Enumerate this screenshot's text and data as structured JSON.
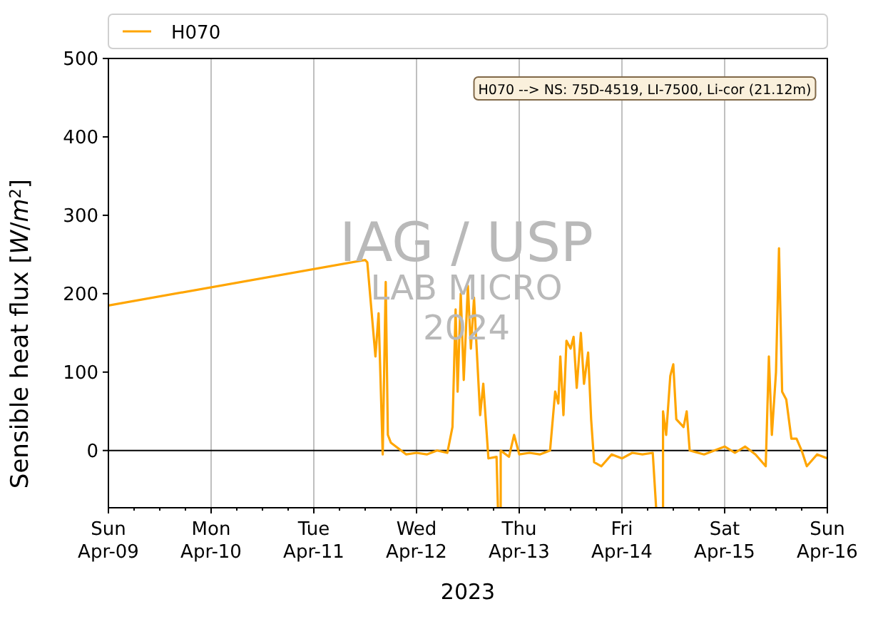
{
  "chart_data": {
    "type": "line",
    "xlabel": "2023",
    "ylabel": "Sensible heat flux [*W*/*m*$^{2}$]",
    "x": [
      "2023-04-09T00:00",
      "2023-04-11T12:00",
      "2023-04-11T12:29",
      "2023-04-11T14:24",
      "2023-04-11T15:07",
      "2023-04-11T16:05",
      "2023-04-11T16:48",
      "2023-04-11T17:17",
      "2023-04-11T18:00",
      "2023-04-11T19:12",
      "2023-04-11T21:36",
      "2023-04-12T00:00",
      "2023-04-12T02:24",
      "2023-04-12T04:48",
      "2023-04-12T07:12",
      "2023-04-12T08:24",
      "2023-04-12T09:07",
      "2023-04-12T09:36",
      "2023-04-12T10:19",
      "2023-04-12T11:02",
      "2023-04-12T12:00",
      "2023-04-12T12:43",
      "2023-04-12T13:26",
      "2023-04-12T14:53",
      "2023-04-12T15:36",
      "2023-04-12T16:48",
      "2023-04-12T18:43",
      "2023-04-12T19:12",
      "2023-04-12T19:41",
      "2023-04-12T21:36",
      "2023-04-12T22:48",
      "2023-04-13T00:00",
      "2023-04-13T02:24",
      "2023-04-13T04:48",
      "2023-04-13T07:12",
      "2023-04-13T08:24",
      "2023-04-13T09:07",
      "2023-04-13T09:36",
      "2023-04-13T10:19",
      "2023-04-13T11:02",
      "2023-04-13T12:00",
      "2023-04-13T12:43",
      "2023-04-13T13:26",
      "2023-04-13T14:24",
      "2023-04-13T15:07",
      "2023-04-13T16:05",
      "2023-04-13T16:48",
      "2023-04-13T17:31",
      "2023-04-13T19:12",
      "2023-04-13T21:36",
      "2023-04-14T00:00",
      "2023-04-14T02:24",
      "2023-04-14T04:48",
      "2023-04-14T07:12",
      "2023-04-14T08:24",
      "2023-04-14T09:36",
      "2023-04-14T10:19",
      "2023-04-14T11:17",
      "2023-04-14T12:00",
      "2023-04-14T12:43",
      "2023-04-14T14:24",
      "2023-04-14T15:07",
      "2023-04-14T15:50",
      "2023-04-14T19:12",
      "2023-04-14T21:36",
      "2023-04-15T00:00",
      "2023-04-15T02:24",
      "2023-04-15T04:48",
      "2023-04-15T07:12",
      "2023-04-15T09:36",
      "2023-04-15T10:19",
      "2023-04-15T11:02",
      "2023-04-15T12:00",
      "2023-04-15T12:43",
      "2023-04-15T13:26",
      "2023-04-15T14:24",
      "2023-04-15T15:36",
      "2023-04-15T16:48",
      "2023-04-15T18:00",
      "2023-04-15T19:12",
      "2023-04-15T21:36",
      "2023-04-16T00:00"
    ],
    "series": [
      {
        "name": "H070",
        "color": "#ffa500",
        "values": [
          185,
          243,
          240,
          120,
          175,
          -5,
          215,
          20,
          10,
          5,
          -5,
          -3,
          -5,
          0,
          -3,
          30,
          180,
          75,
          200,
          90,
          210,
          130,
          195,
          45,
          85,
          -10,
          -8,
          null,
          0,
          -8,
          20,
          -5,
          -3,
          -5,
          0,
          75,
          60,
          120,
          45,
          140,
          130,
          145,
          80,
          150,
          85,
          125,
          40,
          -15,
          -20,
          -5,
          -10,
          -3,
          -5,
          -3,
          null,
          50,
          20,
          95,
          110,
          40,
          30,
          50,
          0,
          -5,
          0,
          5,
          -3,
          5,
          -5,
          -20,
          120,
          20,
          100,
          258,
          75,
          65,
          15,
          15,
          0,
          -20,
          -5,
          -10
        ]
      }
    ],
    "xlim": [
      "2023-04-09T00:00",
      "2023-04-16T00:00"
    ],
    "ylim": [
      -73,
      500
    ],
    "xticks": [
      {
        "value": "2023-04-09T00:00",
        "label": "Sun\nApr-09"
      },
      {
        "value": "2023-04-10T00:00",
        "label": "Mon\nApr-10"
      },
      {
        "value": "2023-04-11T00:00",
        "label": "Tue\nApr-11"
      },
      {
        "value": "2023-04-12T00:00",
        "label": "Wed\nApr-12"
      },
      {
        "value": "2023-04-13T00:00",
        "label": "Thu\nApr-13"
      },
      {
        "value": "2023-04-14T00:00",
        "label": "Fri\nApr-14"
      },
      {
        "value": "2023-04-15T00:00",
        "label": "Sat\nApr-15"
      },
      {
        "value": "2023-04-16T00:00",
        "label": "Sun\nApr-16"
      }
    ],
    "yticks": [
      0,
      100,
      200,
      300,
      400,
      500
    ],
    "grid": "x",
    "annotations": [
      "H070 --> NS: 75D-4519, LI-7500, Li-cor (21.12m)"
    ]
  },
  "watermark": [
    "IAG / USP",
    "LAB MICRO",
    "2024"
  ]
}
